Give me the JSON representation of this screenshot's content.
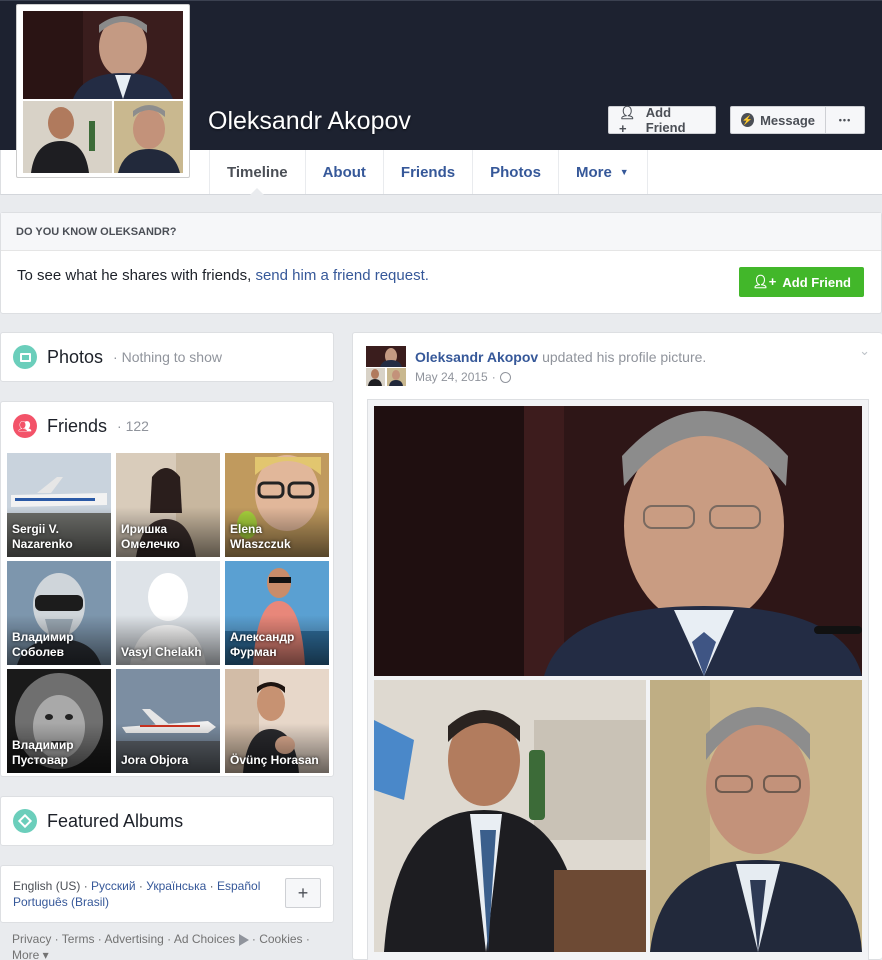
{
  "profile": {
    "name": "Oleksandr Akopov",
    "add_friend_label": "Add Friend",
    "message_label": "Message",
    "more_dots": "•••"
  },
  "nav": {
    "tabs": [
      {
        "label": "Timeline"
      },
      {
        "label": "About"
      },
      {
        "label": "Friends"
      },
      {
        "label": "Photos"
      },
      {
        "label": "More"
      }
    ]
  },
  "know": {
    "heading": "DO YOU KNOW OLEKSANDR?",
    "text": "To see what he shares with friends, ",
    "link": "send him a friend request.",
    "button": "Add Friend"
  },
  "photos_card": {
    "title": "Photos",
    "subtitle": "· Nothing to show"
  },
  "friends_card": {
    "title": "Friends",
    "count": "· 122",
    "friends": [
      {
        "name": "Sergii V. Nazarenko"
      },
      {
        "name": "Иришка Омелечко"
      },
      {
        "name": "Elena Wlaszczuk"
      },
      {
        "name": "Владимир Соболев"
      },
      {
        "name": "Vasyl Chelakh"
      },
      {
        "name": "Александр Фурман"
      },
      {
        "name": "Владимир Пустовар"
      },
      {
        "name": "Jora Objora"
      },
      {
        "name": "Övünç Horasan"
      }
    ]
  },
  "albums_card": {
    "title": "Featured Albums"
  },
  "languages": {
    "current": "English (US) · ",
    "options": [
      "Русский",
      "Українська",
      "Español",
      "Português (Brasil)"
    ],
    "sep": " · ",
    "plus": "+"
  },
  "footer": {
    "links": "Privacy · Terms · Advertising · Ad Choices",
    "links2": " · Cookies ·",
    "more": "More ▾"
  },
  "post": {
    "author": "Oleksandr Akopov",
    "action": " updated his profile picture.",
    "date": "May 24, 2015",
    "sep": " · "
  },
  "colors": {
    "link": "#365899",
    "green": "#42b72a",
    "photos_icon": "#6bcebb",
    "friends_icon": "#f35369",
    "albums_icon": "#6bcebb"
  }
}
